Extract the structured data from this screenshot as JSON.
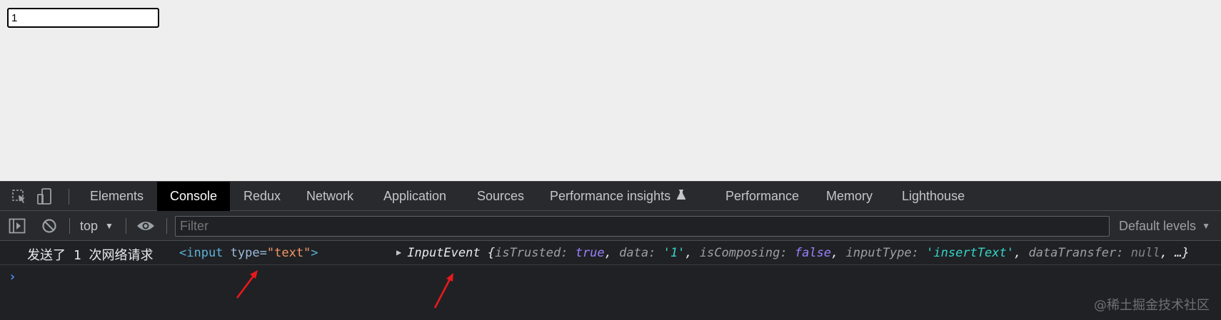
{
  "page": {
    "input_value": "1"
  },
  "devtools": {
    "tabs": [
      {
        "label": "Elements"
      },
      {
        "label": "Console"
      },
      {
        "label": "Redux"
      },
      {
        "label": "Network"
      },
      {
        "label": "Application"
      },
      {
        "label": "Sources"
      },
      {
        "label": "Performance insights"
      },
      {
        "label": "Performance"
      },
      {
        "label": "Memory"
      },
      {
        "label": "Lighthouse"
      }
    ],
    "active_tab": "Console",
    "toolbar": {
      "context": "top",
      "filter_placeholder": "Filter",
      "levels": "Default levels"
    },
    "icons": {
      "inspect": "inspect-element-icon",
      "device": "device-toolbar-icon",
      "sidebar": "show-sidebar-icon",
      "clear": "clear-console-icon",
      "eye": "live-expression-icon",
      "flask": "experimental-flask-icon",
      "expand": "expand-triangle-icon"
    },
    "console": {
      "log": {
        "text": "发送了 1 次网络请求",
        "element_tag_open": "<input",
        "element_attr_name": "type",
        "element_attr_eq": "=",
        "element_attr_value": "\"text\"",
        "element_tag_close": ">",
        "event_name": "InputEvent",
        "event_open": "{",
        "k1": "isTrusted",
        "v1": "true",
        "k2": "data",
        "v2": "'1'",
        "k3": "isComposing",
        "v3": "false",
        "k4": "inputType",
        "v4": "'insertText'",
        "k5": "dataTransfer",
        "v5": "null",
        "event_close": ", …}",
        "colon": ": ",
        "comma": ", "
      },
      "prompt": "›"
    }
  },
  "watermark": "@稀土掘金技术社区",
  "colors": {
    "page_bg": "#eeeeee",
    "devtools_bg": "#202124",
    "toolbar_bg": "#292a2d",
    "active_tab_bg": "#000000",
    "annotation_arrow": "#e8191c"
  }
}
